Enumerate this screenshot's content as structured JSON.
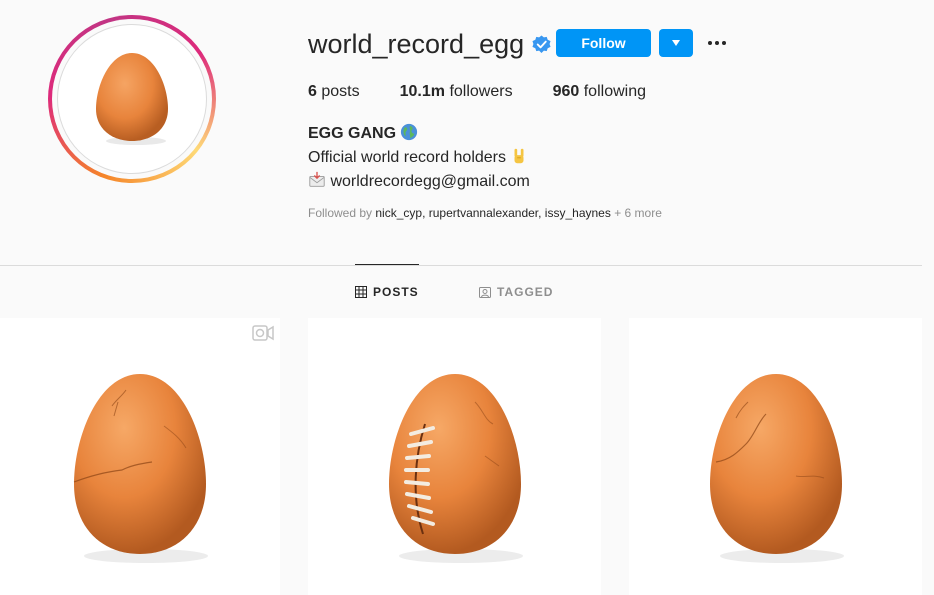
{
  "profile": {
    "username": "world_record_egg",
    "verified": true,
    "follow_label": "Follow",
    "stats": {
      "posts_count": "6",
      "posts_label": "posts",
      "followers_count": "10.1m",
      "followers_label": "followers",
      "following_count": "960",
      "following_label": "following"
    },
    "bio": {
      "name": "EGG GANG",
      "line1": "Official world record holders",
      "email": "worldrecordegg@gmail.com"
    },
    "followed_by": {
      "prefix": "Followed by",
      "names": "nick_cyp, rupertvannalexander, issy_haynes",
      "more": "+ 6 more"
    }
  },
  "tabs": [
    {
      "label": "POSTS",
      "active": true,
      "icon": "grid-icon"
    },
    {
      "label": "TAGGED",
      "active": false,
      "icon": "tagged-icon"
    }
  ],
  "posts": [
    {
      "type": "video",
      "variant": "cracked-egg"
    },
    {
      "type": "image",
      "variant": "football-egg"
    },
    {
      "type": "image",
      "variant": "cracked-egg"
    }
  ],
  "colors": {
    "accent": "#0095f6",
    "egg": "#e8843c",
    "muted": "#8e8e8e"
  }
}
